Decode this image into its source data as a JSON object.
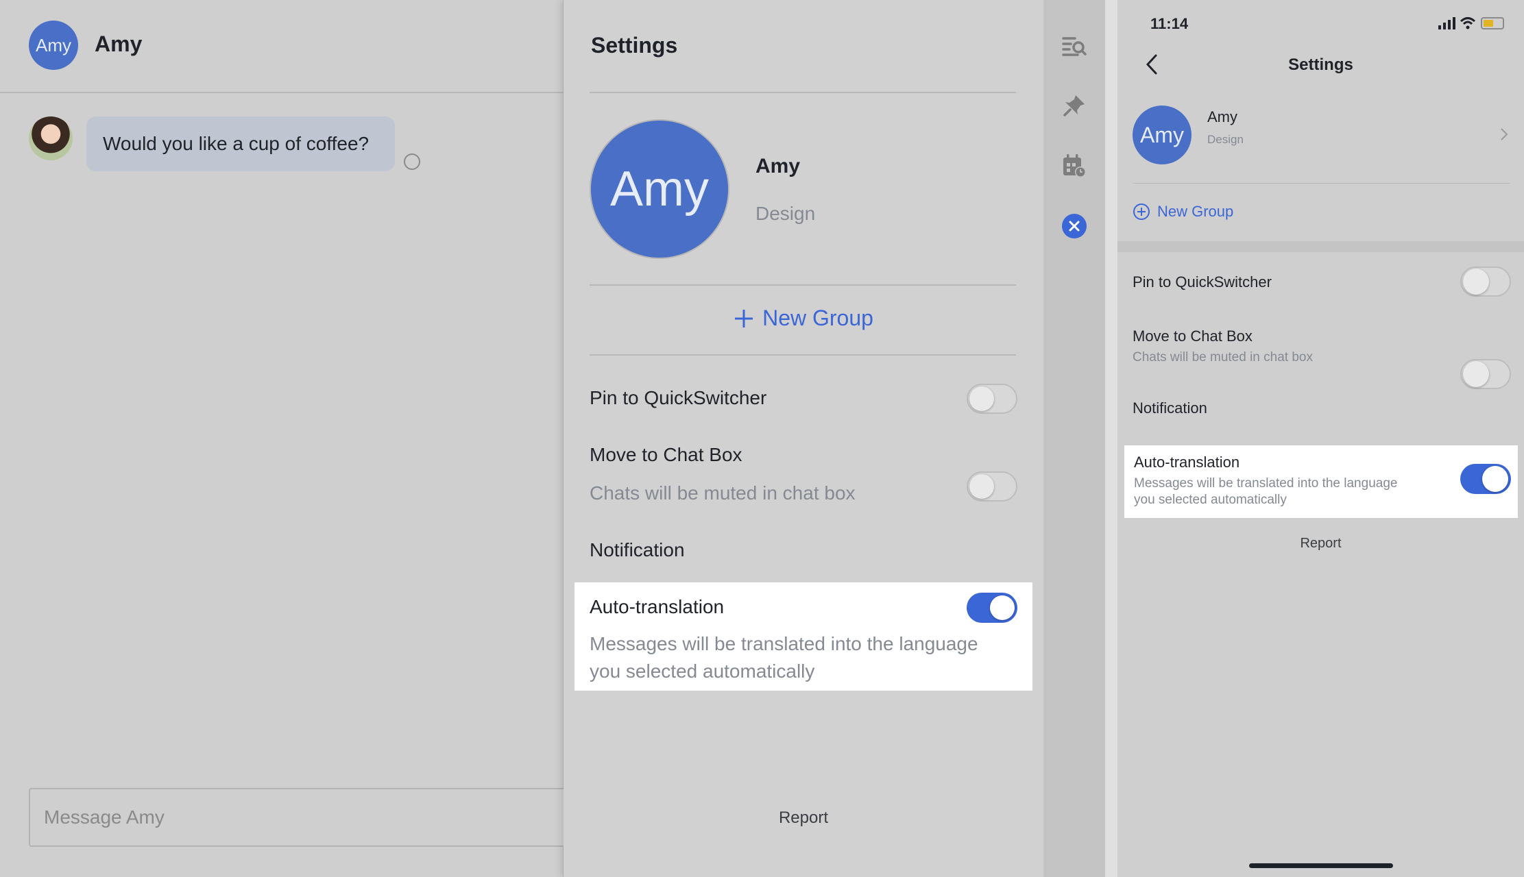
{
  "chat": {
    "contact_name": "Amy",
    "avatar_text": "Amy",
    "message": "Would you like a cup of coffee?",
    "input_placeholder": "Message Amy"
  },
  "settings": {
    "title": "Settings",
    "profile": {
      "avatar_text": "Amy",
      "name": "Amy",
      "department": "Design"
    },
    "new_group_label": "New Group",
    "rows": [
      {
        "title": "Pin to QuickSwitcher",
        "subtitle": "",
        "enabled": false
      },
      {
        "title": "Move to Chat Box",
        "subtitle": "Chats will be muted in chat box",
        "enabled": false
      },
      {
        "title": "Notification",
        "subtitle": "",
        "enabled": true
      },
      {
        "title": "Auto-translation",
        "subtitle": "Messages will be translated into the language you selected automatically",
        "subtitle_line1": "Messages will be translated into the language",
        "subtitle_line2": "you selected automatically",
        "enabled": true
      }
    ],
    "report_label": "Report"
  },
  "rail": {
    "icons": [
      "search-messages-icon",
      "pin-icon",
      "calendar-icon",
      "close-icon"
    ]
  },
  "mobile": {
    "status_time": "11:14",
    "title": "Settings",
    "profile": {
      "avatar_text": "Amy",
      "name": "Amy",
      "department": "Design"
    },
    "new_group_label": "New Group",
    "rows": [
      {
        "title": "Pin to QuickSwitcher",
        "subtitle": "",
        "enabled": false
      },
      {
        "title": "Move to Chat Box",
        "subtitle": "Chats will be muted in chat box",
        "enabled": false
      },
      {
        "title": "Notification",
        "subtitle": "",
        "enabled": true
      },
      {
        "title": "Auto-translation",
        "subtitle_line1": "Messages will be translated into the language",
        "subtitle_line2": "you selected automatically",
        "enabled": true
      }
    ],
    "report_label": "Report"
  },
  "colors": {
    "accent": "#3b66d6",
    "avatar": "#4a6fc7",
    "background": "#cfcfcf"
  }
}
